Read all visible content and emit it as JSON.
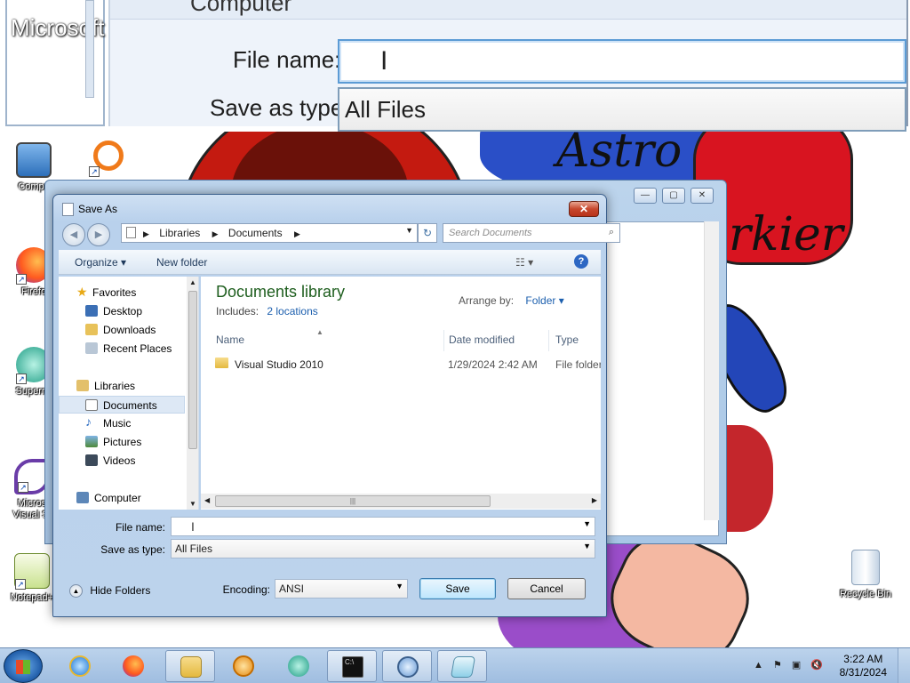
{
  "zoom": {
    "left_text": "Microsoft Visual St",
    "computer_label": "Computer",
    "file_name_label": "File name:",
    "save_as_type_label": "Save as type:",
    "save_as_type_value": "All Files"
  },
  "wallpaper": {
    "text1": "Astro",
    "text2": "rkier"
  },
  "desktop_icons": [
    {
      "label": "Compu"
    },
    {
      "label": "Firefo"
    },
    {
      "label": "Supermi"
    },
    {
      "label": "Micros Visual St"
    },
    {
      "label": "Notepad+"
    },
    {
      "label": "Recycle Bin"
    }
  ],
  "notepad_window": {
    "minimize": "—",
    "maximize": "▢",
    "close": "✕"
  },
  "dialog": {
    "title": "Save As",
    "close_label": "✕",
    "address": {
      "segments": [
        "Libraries",
        "Documents"
      ]
    },
    "search_placeholder": "Search Documents",
    "toolbar": {
      "organize": "Organize ▾",
      "new_folder": "New folder",
      "views": "☷ ▾",
      "help": "?"
    },
    "nav": {
      "favorites": "Favorites",
      "desktop": "Desktop",
      "downloads": "Downloads",
      "recent": "Recent Places",
      "libraries": "Libraries",
      "documents": "Documents",
      "music": "Music",
      "pictures": "Pictures",
      "videos": "Videos",
      "computer": "Computer"
    },
    "content": {
      "library_title": "Documents library",
      "includes_label": "Includes:",
      "includes_link": "2 locations",
      "arrange_label": "Arrange by:",
      "arrange_value": "Folder ▾",
      "columns": [
        "Name",
        "Date modified",
        "Type"
      ],
      "rows": [
        {
          "name": "Visual Studio 2010",
          "date": "1/29/2024 2:42 AM",
          "type": "File folder"
        }
      ]
    },
    "form": {
      "file_name_label": "File name:",
      "file_name_value": "",
      "save_as_type_label": "Save as type:",
      "save_as_type_value": "All Files",
      "encoding_label": "Encoding:",
      "encoding_value": "ANSI"
    },
    "buttons": {
      "hide_folders": "Hide Folders",
      "save": "Save",
      "cancel": "Cancel"
    }
  },
  "taskbar": {
    "time": "3:22 AM",
    "date": "8/31/2024",
    "tray_icons": "▲  ⚑  ▣  🔇"
  },
  "colors": {
    "library_title": "#1e5e1e",
    "link": "#1c5fae",
    "taskbar": "#bcd3ec"
  }
}
